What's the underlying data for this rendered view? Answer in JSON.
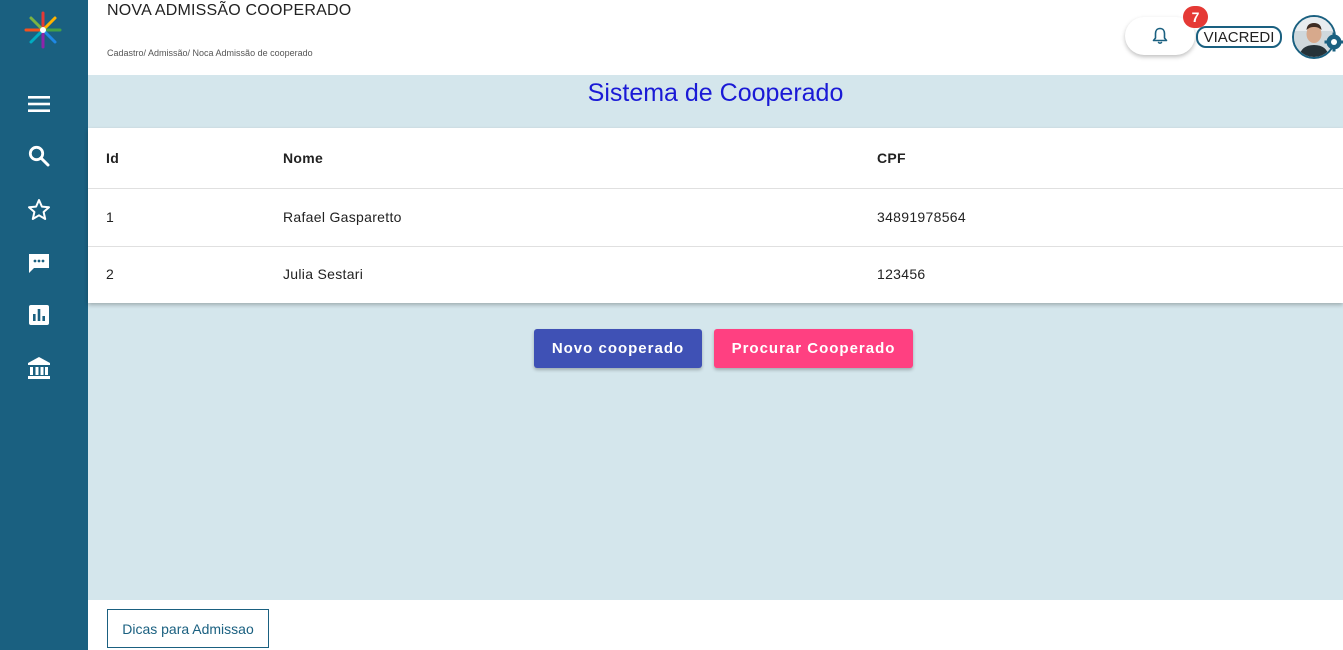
{
  "header": {
    "title": "NOVA ADMISSÃO COOPERADO",
    "breadcrumb": "Cadastro/ Admissão/ Noca Admissão de cooperado",
    "notification_count": "7",
    "organization": "VIACREDI"
  },
  "sidebar": {
    "items": [
      {
        "icon": "menu-icon"
      },
      {
        "icon": "search-icon"
      },
      {
        "icon": "star-icon"
      },
      {
        "icon": "chat-icon"
      },
      {
        "icon": "bar-chart-icon"
      },
      {
        "icon": "bank-icon"
      }
    ]
  },
  "main": {
    "title": "Sistema de Cooperado",
    "table": {
      "headers": [
        "Id",
        "Nome",
        "CPF"
      ],
      "rows": [
        [
          "1",
          "Rafael Gasparetto",
          "34891978564"
        ],
        [
          "2",
          "Julia Sestari",
          "123456"
        ]
      ]
    },
    "buttons": {
      "new_label": "Novo cooperado",
      "search_label": "Procurar Cooperado"
    }
  },
  "footer": {
    "tips_label": "Dicas para Admissao"
  },
  "colors": {
    "sidebar": "#1a6080",
    "content_bg": "#d4e6ec",
    "title": "#1a1ad6",
    "primary_button": "#3f51b5",
    "accent_button": "#ff4081",
    "badge": "#e53935"
  }
}
